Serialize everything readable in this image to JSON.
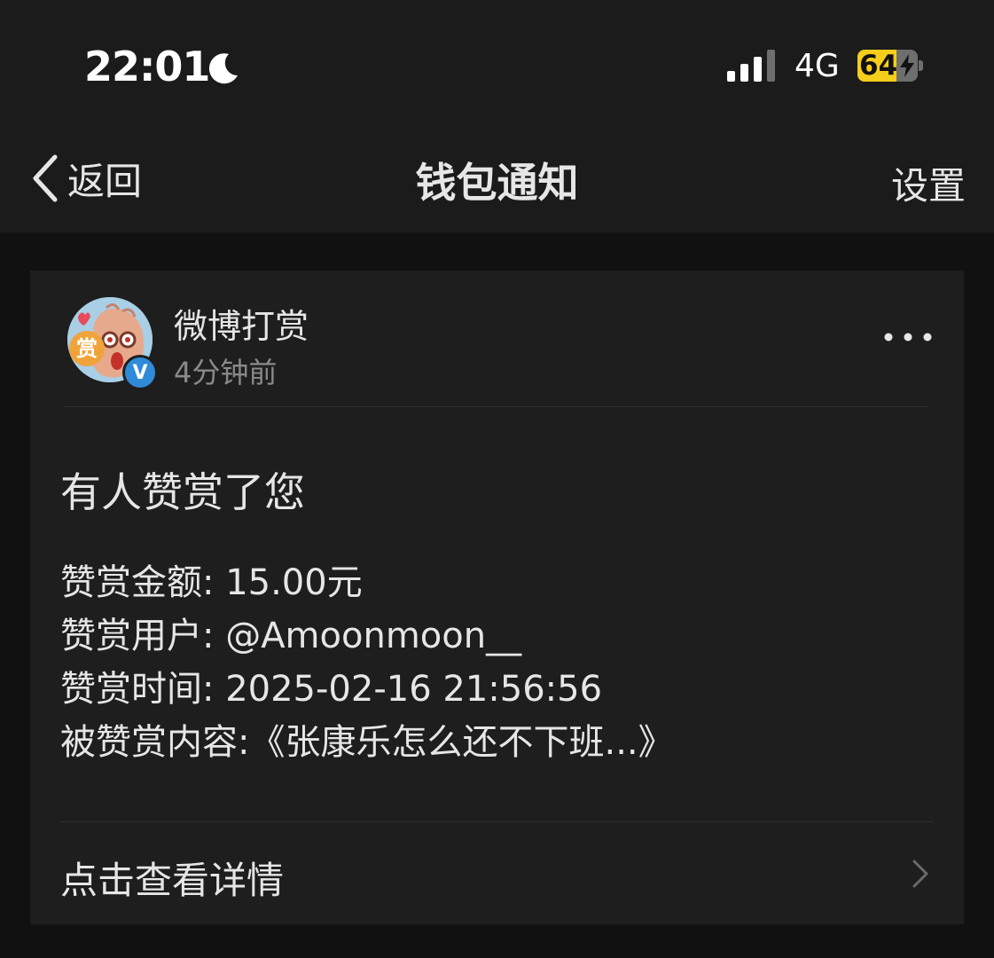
{
  "status_bar": {
    "time": "22:01",
    "network": "4G",
    "battery_level": "64",
    "battery_fraction": 0.64,
    "icons": [
      "moon-icon",
      "signal-icon",
      "bolt-icon"
    ]
  },
  "nav": {
    "back_label": "返回",
    "title": "钱包通知",
    "settings_label": "设置"
  },
  "card": {
    "sender_name": "微博打赏",
    "time_ago": "4分钟前",
    "avatar_text": "赏",
    "verified_mark": "V",
    "message_title": "有人赞赏了您",
    "details": [
      "赞赏金额: 15.00元",
      "赞赏用户: @Amoonmoon__",
      "赞赏时间: 2025-02-16 21:56:56",
      "被赞赏内容:《张康乐怎么还不下班...》"
    ],
    "view_details_label": "点击查看详情"
  },
  "colors": {
    "background": "#111111",
    "header": "#1b1b1b",
    "card": "#1e1e1e",
    "text": "#e6e6e6",
    "muted": "#8a8a8a",
    "battery": "#f5cd1b",
    "verified": "#2f8ad8"
  }
}
